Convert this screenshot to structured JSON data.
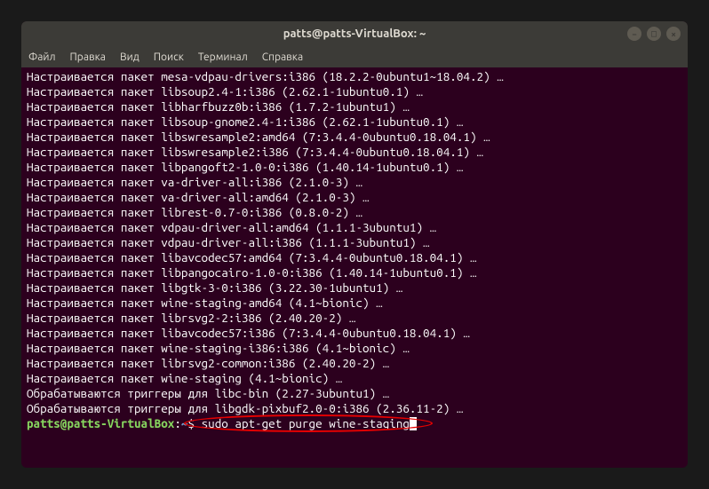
{
  "window": {
    "title": "patts@patts-VirtualBox: ~"
  },
  "menubar": {
    "items": [
      "Файл",
      "Правка",
      "Вид",
      "Поиск",
      "Терминал",
      "Справка"
    ]
  },
  "terminal": {
    "lines": [
      "Настраивается пакет mesa-vdpau-drivers:i386 (18.2.2-0ubuntu1~18.04.2) …",
      "Настраивается пакет libsoup2.4-1:i386 (2.62.1-1ubuntu0.1) …",
      "Настраивается пакет libharfbuzz0b:i386 (1.7.2-1ubuntu1) …",
      "Настраивается пакет libsoup-gnome2.4-1:i386 (2.62.1-1ubuntu0.1) …",
      "Настраивается пакет libswresample2:amd64 (7:3.4.4-0ubuntu0.18.04.1) …",
      "Настраивается пакет libswresample2:i386 (7:3.4.4-0ubuntu0.18.04.1) …",
      "Настраивается пакет libpangoft2-1.0-0:i386 (1.40.14-1ubuntu0.1) …",
      "Настраивается пакет va-driver-all:i386 (2.1.0-3) …",
      "Настраивается пакет va-driver-all:amd64 (2.1.0-3) …",
      "Настраивается пакет librest-0.7-0:i386 (0.8.0-2) …",
      "Настраивается пакет vdpau-driver-all:amd64 (1.1.1-3ubuntu1) …",
      "Настраивается пакет vdpau-driver-all:i386 (1.1.1-3ubuntu1) …",
      "Настраивается пакет libavcodec57:amd64 (7:3.4.4-0ubuntu0.18.04.1) …",
      "Настраивается пакет libpangocairo-1.0-0:i386 (1.40.14-1ubuntu0.1) …",
      "Настраивается пакет libgtk-3-0:i386 (3.22.30-1ubuntu1) …",
      "Настраивается пакет wine-staging-amd64 (4.1~bionic) …",
      "Настраивается пакет librsvg2-2:i386 (2.40.20-2) …",
      "Настраивается пакет libavcodec57:i386 (7:3.4.4-0ubuntu0.18.04.1) …",
      "Настраивается пакет wine-staging-i386:i386 (4.1~bionic) …",
      "Настраивается пакет librsvg2-common:i386 (2.40.20-2) …",
      "Настраивается пакет wine-staging (4.1~bionic) …",
      "Обрабатываются триггеры для libc-bin (2.27-3ubuntu1) …",
      "Обрабатываются триггеры для libgdk-pixbuf2.0-0:i386 (2.36.11-2) …"
    ],
    "prompt": {
      "user": "patts@patts-VirtualBox",
      "colon": ":",
      "path": "~",
      "dollar": "$",
      "command": "sudo apt-get purge wine-staging "
    }
  }
}
